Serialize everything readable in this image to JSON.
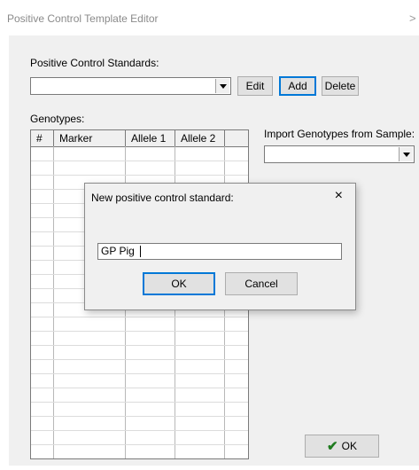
{
  "window": {
    "title": "Positive Control Template Editor",
    "close_glyph": ">"
  },
  "standards": {
    "label": "Positive Control Standards:",
    "selected": "",
    "edit_label": "Edit",
    "add_label": "Add",
    "delete_label": "Delete"
  },
  "genotypes": {
    "label": "Genotypes:",
    "columns": [
      "#",
      "Marker",
      "Allele 1",
      "Allele 2"
    ]
  },
  "import": {
    "label": "Import Genotypes from Sample:",
    "selected": ""
  },
  "ok_button": {
    "label": "OK"
  },
  "dialog": {
    "title": "New positive control standard:",
    "close_glyph": "×",
    "input_value": "GP Pig",
    "ok_label": "OK",
    "cancel_label": "Cancel"
  },
  "colors": {
    "accent": "#0078d7",
    "check": "#1e7b1e"
  }
}
